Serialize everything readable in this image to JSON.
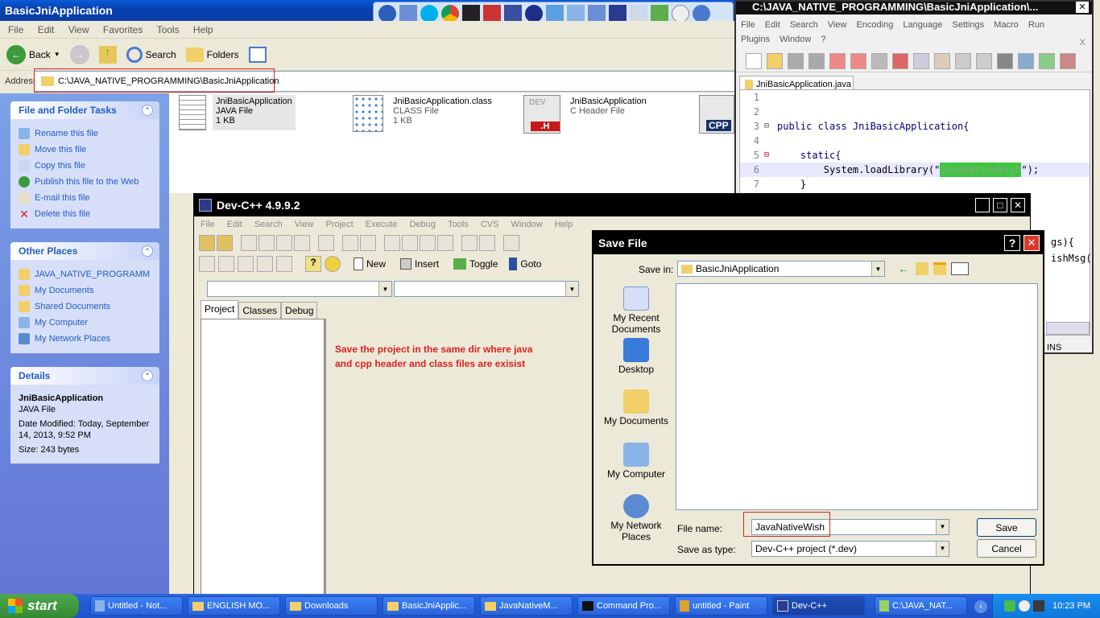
{
  "explorer": {
    "title": "BasicJniApplication",
    "menu": [
      "File",
      "Edit",
      "View",
      "Favorites",
      "Tools",
      "Help"
    ],
    "toolbar": {
      "back": "Back",
      "search": "Search",
      "folders": "Folders"
    },
    "address_label": "Address",
    "address_value": "C:\\JAVA_NATIVE_PROGRAMMING\\BasicJniApplication",
    "tasks_title": "File and Folder Tasks",
    "tasks": [
      "Rename this file",
      "Move this file",
      "Copy this file",
      "Publish this file to the Web",
      "E-mail this file",
      "Delete this file"
    ],
    "places_title": "Other Places",
    "places": [
      "JAVA_NATIVE_PROGRAMM",
      "My Documents",
      "Shared Documents",
      "My Computer",
      "My Network Places"
    ],
    "details_title": "Details",
    "details": {
      "name": "JniBasicApplication",
      "type": "JAVA File",
      "modified": "Date Modified: Today, September 14, 2013, 9:52 PM",
      "size": "Size: 243 bytes"
    },
    "files": [
      {
        "name": "JniBasicApplication",
        "type": "JAVA File",
        "size": "1 KB"
      },
      {
        "name": "JniBasicApplication.class",
        "type": "CLASS File",
        "size": "1 KB"
      },
      {
        "name": "JniBasicApplication",
        "type": "C Header File",
        "size": ""
      }
    ],
    "h_badge": ".H",
    "cpp_badge": "CPP",
    "dev_badge": "DEV"
  },
  "npp": {
    "title": "C:\\JAVA_NATIVE_PROGRAMMING\\BasicJniApplication\\...",
    "menu": [
      "File",
      "Edit",
      "Search",
      "View",
      "Encoding",
      "Language",
      "Settings",
      "Macro",
      "Run",
      "Plugins",
      "Window",
      "?"
    ],
    "close_x": "X",
    "tab": "JniBasicApplication.java",
    "lines": [
      {
        "n": "1",
        "text": ""
      },
      {
        "n": "2",
        "text": ""
      },
      {
        "n": "3",
        "text": "public class JniBasicApplication{"
      },
      {
        "n": "4",
        "text": ""
      },
      {
        "n": "5",
        "text": "    static{"
      },
      {
        "n": "6",
        "pre": "        System.loadLibrary(\"",
        "hl": "JavaNativeWish",
        "post": "\");"
      },
      {
        "n": "7",
        "text": "    }"
      }
    ],
    "partial_1": "gs){",
    "partial_2": "ishMsg(",
    "status_ins": "INS"
  },
  "devcpp": {
    "title": "Dev-C++ 4.9.9.2",
    "menu": [
      "File",
      "Edit",
      "Search",
      "View",
      "Project",
      "Execute",
      "Debug",
      "Tools",
      "CVS",
      "Window",
      "Help"
    ],
    "toolbar2": {
      "new": "New",
      "insert": "Insert",
      "toggle": "Toggle",
      "goto": "Goto"
    },
    "tabs": [
      "Project",
      "Classes",
      "Debug"
    ],
    "annotation": "Save the project in the same dir where java and cpp header and class files are exisist"
  },
  "dialog": {
    "title": "Save File",
    "help": "?",
    "save_in_label": "Save in:",
    "save_in_value": "BasicJniApplication",
    "places": [
      "My Recent Documents",
      "Desktop",
      "My Documents",
      "My Computer",
      "My Network Places"
    ],
    "filename_label": "File name:",
    "filename_value": "JavaNativeWish",
    "type_label": "Save as type:",
    "type_value": "Dev-C++ project (*.dev)",
    "save_btn": "Save",
    "cancel_btn": "Cancel"
  },
  "taskbar": {
    "start": "start",
    "items": [
      "Untitled - Not...",
      "ENGLISH MO...",
      "Downloads",
      "BasicJniApplic...",
      "JavaNativeM...",
      "Command Pro...",
      "untitled - Paint",
      "Dev-C++",
      "C:\\JAVA_NAT..."
    ],
    "active": 7,
    "clock": "10:23 PM"
  },
  "colors": {
    "xp_blue": "#0a5bd8",
    "taskbar": "#245edb",
    "start_green": "#3c9a3c",
    "annotation_red": "#e02020",
    "highlight_box": "#e02020"
  }
}
